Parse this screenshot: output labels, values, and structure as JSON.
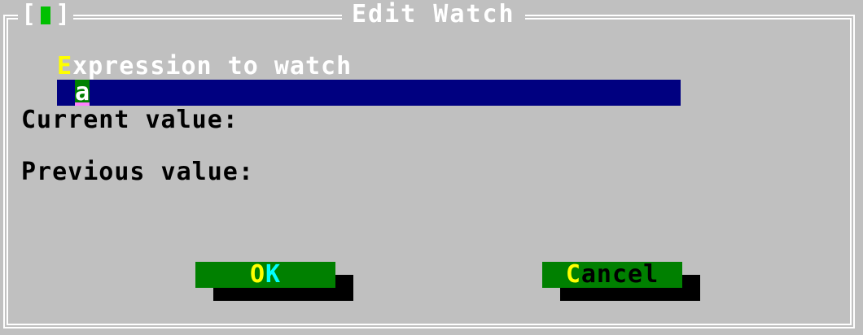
{
  "window": {
    "title": "Edit Watch",
    "close_left": "[",
    "close_right": "]"
  },
  "expression": {
    "label_hotkey": "E",
    "label_rest": "xpression to watch",
    "value": "a"
  },
  "fields": {
    "current_value_label": "Current value:",
    "previous_value_label": "Previous value:"
  },
  "buttons": {
    "ok_hotkey": "O",
    "ok_rest": "K",
    "cancel_hotkey": "C",
    "cancel_rest": "ancel"
  },
  "colors": {
    "dialog_background": "#c0c0c0",
    "input_background": "#000080",
    "button_background": "#008000",
    "hotkey": "#ffff00",
    "frame": "#ffffff"
  },
  "icons": {
    "close": "close-box-icon"
  }
}
